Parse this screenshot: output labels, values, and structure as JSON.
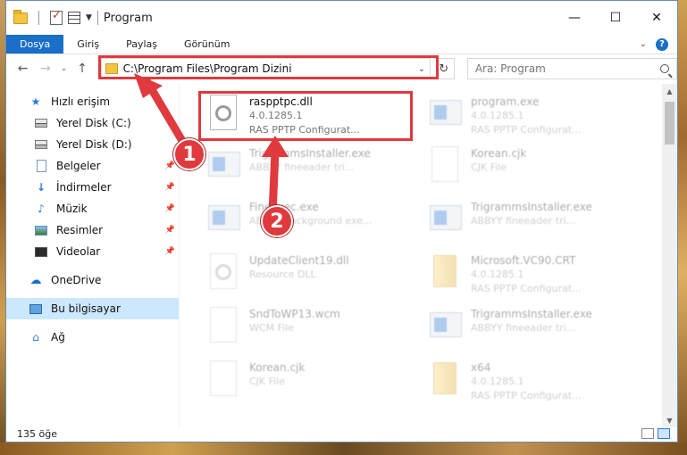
{
  "window": {
    "title": "Program",
    "controls": [
      "minimize",
      "maximize",
      "close"
    ]
  },
  "ribbon": {
    "tabs": [
      "Dosya",
      "Giriş",
      "Paylaş",
      "Görünüm"
    ],
    "help_label": "?"
  },
  "nav": {
    "address": "C:\\Program Files\\Program Dizini",
    "search_placeholder": "Ara: Program"
  },
  "sidebar": {
    "items": [
      {
        "label": "Hızlı erişim",
        "icon": "star-icon"
      },
      {
        "label": "Yerel Disk (C:)",
        "icon": "drive-icon"
      },
      {
        "label": "Yerel Disk (D:)",
        "icon": "drive-icon"
      },
      {
        "label": "Belgeler",
        "icon": "documents-icon",
        "pinned": true
      },
      {
        "label": "İndirmeler",
        "icon": "download-icon",
        "pinned": true
      },
      {
        "label": "Müzik",
        "icon": "music-icon",
        "pinned": true
      },
      {
        "label": "Resimler",
        "icon": "pictures-icon",
        "pinned": true
      },
      {
        "label": "Videolar",
        "icon": "videos-icon",
        "pinned": true
      },
      {
        "label": "OneDrive",
        "icon": "cloud-icon"
      },
      {
        "label": "Bu bilgisayar",
        "icon": "computer-icon",
        "selected": true
      },
      {
        "label": "Ağ",
        "icon": "network-icon"
      }
    ]
  },
  "files": [
    {
      "name": "raspptpc.dll",
      "line2": "4.0.1285.1",
      "line3": "RAS PPTP Configurat...",
      "icon": "dll-gear-icon",
      "highlighted": true
    },
    {
      "name": "program.exe",
      "line2": "4.0.1285.1",
      "line3": "RAS PPTP Configurat...",
      "icon": "exe-icon"
    },
    {
      "name": "TrigrammsInstaller.exe",
      "line2": "ABBYY fineeader tri...",
      "line3": "",
      "icon": "app-icon"
    },
    {
      "name": "Korean.cjk",
      "line2": "CJK File",
      "line3": "",
      "icon": "file-icon"
    },
    {
      "name": "FineExec.exe",
      "line2": "ABBYY background exe...",
      "line3": "",
      "icon": "app-icon"
    },
    {
      "name": "TrigrammsInstaller.exe",
      "line2": "ABBYY fineeader tri...",
      "line3": "",
      "icon": "app-icon"
    },
    {
      "name": "UpdateClient19.dll",
      "line2": "Resource DLL",
      "line3": "",
      "icon": "dll-gear-icon"
    },
    {
      "name": "Microsoft.VC90.CRT",
      "line2": "4.0.1285.1",
      "line3": "RAS PPTP Configurat...",
      "icon": "folder-zip-icon"
    },
    {
      "name": "SndToWP13.wcm",
      "line2": "WCM File",
      "line3": "",
      "icon": "file-icon"
    },
    {
      "name": "TrigrammsInstaller.exe",
      "line2": "ABBYY fineeader tri...",
      "line3": "",
      "icon": "app-icon"
    },
    {
      "name": "Korean.cjk",
      "line2": "CJK File",
      "line3": "",
      "icon": "file-icon"
    },
    {
      "name": "x64",
      "line2": "4.0.1285.1",
      "line3": "RAS PPTP Configurat...",
      "icon": "folder-zip-icon"
    }
  ],
  "status": {
    "count": "135 öğe"
  },
  "annotations": {
    "badge1": "1",
    "badge2": "2",
    "highlight_color": "#e0393e"
  }
}
